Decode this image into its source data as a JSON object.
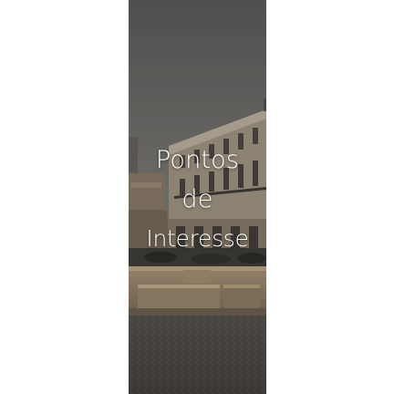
{
  "banner": {
    "title_lines": [
      "Pontos",
      "de",
      "Interesse"
    ],
    "image_subject": "town-square-fountain-photo",
    "overlay_color": "#141414"
  }
}
